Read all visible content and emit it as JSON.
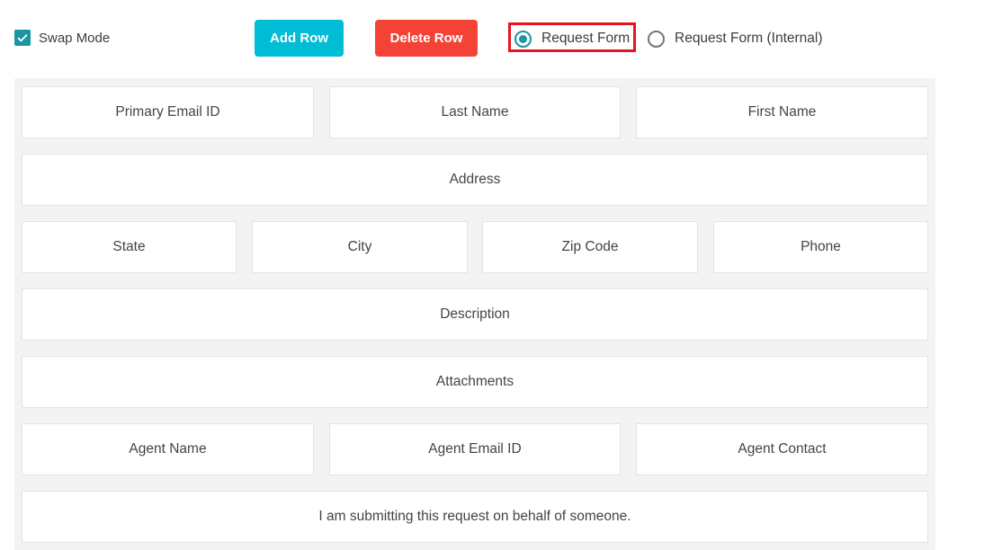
{
  "toolbar": {
    "swap_mode": {
      "label": "Swap Mode",
      "checked": true
    },
    "add_row_label": "Add Row",
    "delete_row_label": "Delete Row",
    "form_type": {
      "options": [
        {
          "label": "Request Form",
          "selected": true
        },
        {
          "label": "Request Form (Internal)",
          "selected": false
        }
      ]
    }
  },
  "colors": {
    "accent_teal": "#1a95a3",
    "add_button": "#00bcd4",
    "delete_button": "#f44336",
    "highlight_border": "#e8141d",
    "grid_background": "#f3f3f3"
  },
  "form": {
    "rows": [
      {
        "fields": [
          "Primary Email ID",
          "Last Name",
          "First Name"
        ]
      },
      {
        "fields": [
          "Address"
        ]
      },
      {
        "fields": [
          "State",
          "City",
          "Zip Code",
          "Phone"
        ]
      },
      {
        "fields": [
          "Description"
        ]
      },
      {
        "fields": [
          "Attachments"
        ]
      },
      {
        "fields": [
          "Agent Name",
          "Agent Email ID",
          "Agent Contact"
        ]
      },
      {
        "fields": [
          "I am submitting this request on behalf of someone."
        ]
      }
    ]
  }
}
